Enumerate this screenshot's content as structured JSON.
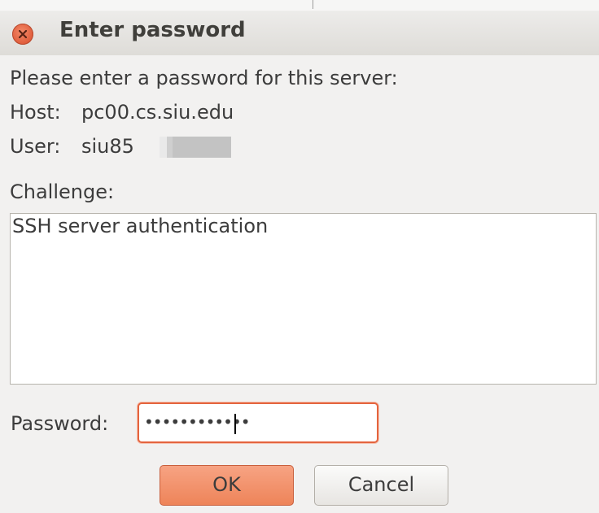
{
  "window": {
    "title": "Enter password"
  },
  "prompt": "Please enter a password for this server:",
  "host": {
    "label": "Host:",
    "value": "pc00.cs.siu.edu"
  },
  "user": {
    "label": "User:",
    "value": "siu85"
  },
  "challenge": {
    "label": "Challenge:",
    "text": "SSH server authentication"
  },
  "password": {
    "label": "Password:",
    "masked_value": "••••••••••••"
  },
  "buttons": {
    "ok_label": "OK",
    "cancel_label": "Cancel"
  },
  "icons": {
    "close": "close-icon"
  },
  "colors": {
    "accent": "#e4643e",
    "ok_button": "#ee8459",
    "close_button": "#df5b3a"
  }
}
